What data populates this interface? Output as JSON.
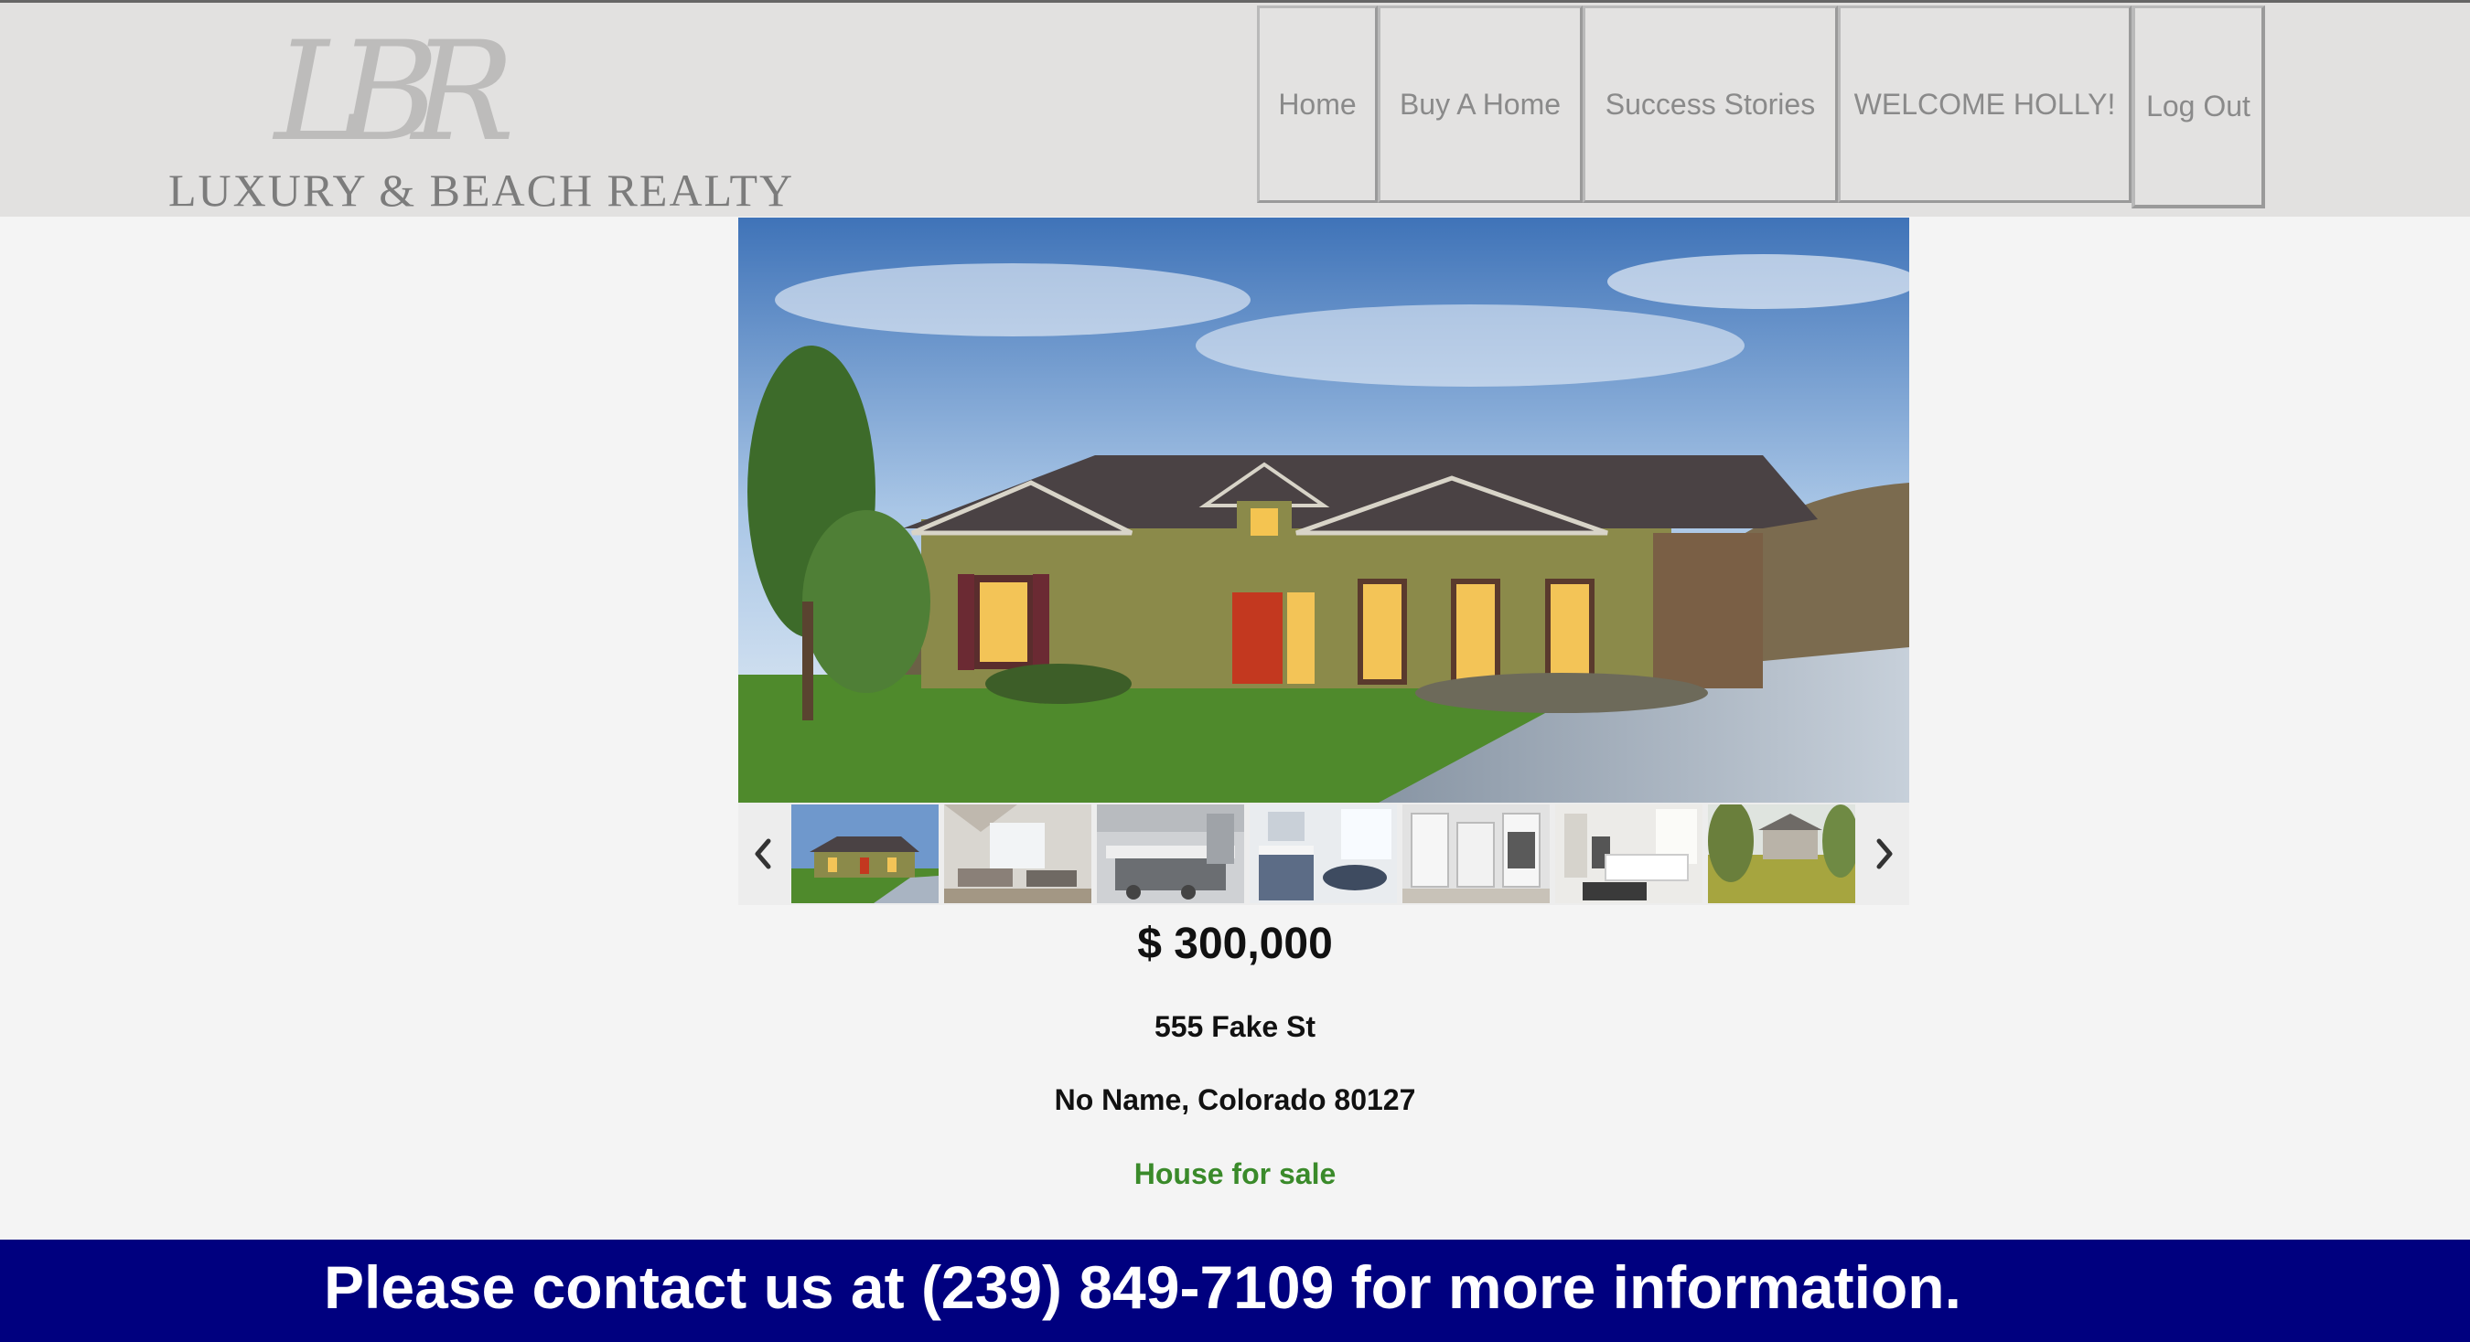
{
  "brand": {
    "monogram": "LBR",
    "name": "LUXURY & BEACH REALTY"
  },
  "nav": {
    "items": [
      {
        "label": "Home"
      },
      {
        "label": "Buy A Home"
      },
      {
        "label": "Success Stories"
      },
      {
        "label": "WELCOME HOLLY!"
      },
      {
        "label": "Log Out"
      }
    ]
  },
  "gallery": {
    "prev_icon": "chevron-left-icon",
    "next_icon": "chevron-right-icon",
    "thumbnail_count": 7
  },
  "listing": {
    "price": "$ 300,000",
    "street": "555 Fake St",
    "city_state_zip": "No Name, Colorado 80127",
    "status": "House for sale"
  },
  "banner": {
    "text": "Please contact us at (239) 849-7109 for more information."
  },
  "colors": {
    "header_bg": "#e2e1e0",
    "page_bg": "#f4f4f4",
    "status_green": "#3a8a2a",
    "banner_bg": "#00007f"
  }
}
